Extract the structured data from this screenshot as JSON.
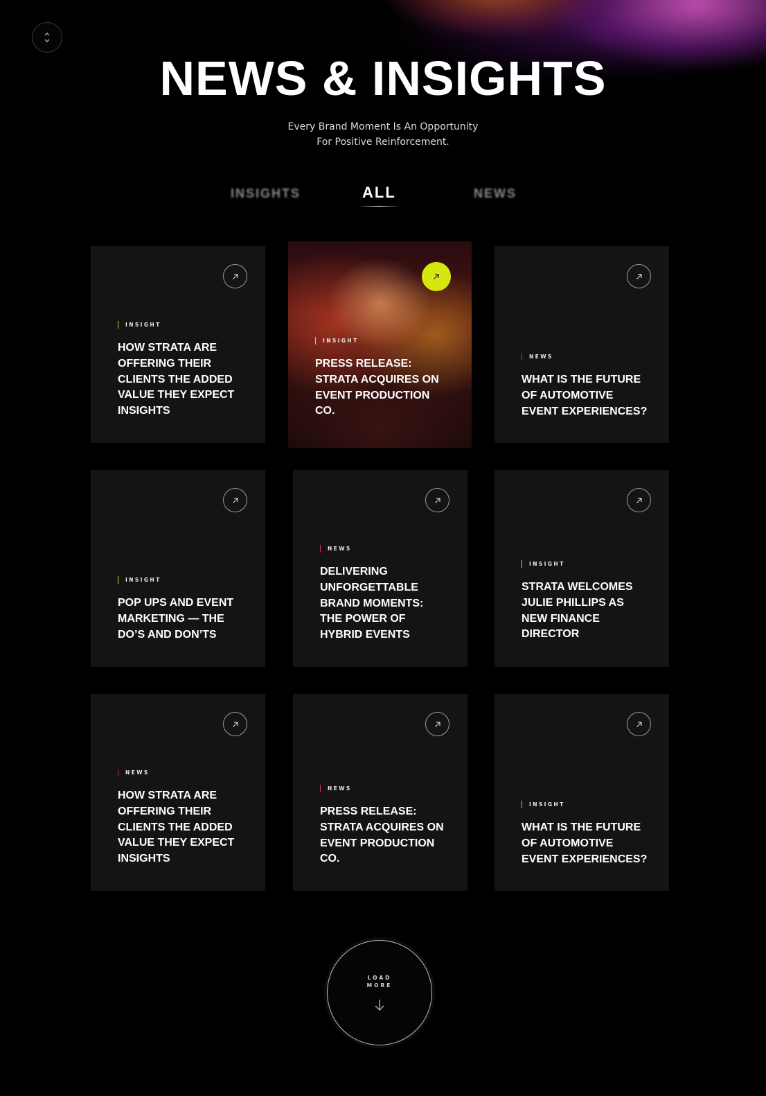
{
  "header": {
    "title": "NEWS & INSIGHTS",
    "subtitle_line1": "Every Brand Moment Is An Opportunity",
    "subtitle_line2": "For Positive Reinforcement."
  },
  "tabs": [
    {
      "label": "INSIGHTS",
      "active": false
    },
    {
      "label": "ALL",
      "active": true
    },
    {
      "label": "NEWS",
      "active": false
    }
  ],
  "colors": {
    "accent_lime": "#d6e60f",
    "insight_marker": "#cfe01a",
    "news_marker": "#e0245e",
    "card_bg": "#141414"
  },
  "cards": [
    {
      "tag": "INSIGHT",
      "title_lines": [
        "HOW STRATA ARE",
        "OFFERING THEIR",
        "CLIENTS THE ADDED",
        "VALUE THEY EXPECT",
        "INSIGHTS"
      ],
      "icon": "arrow-up-right-icon"
    },
    {
      "tag": "INSIGHT",
      "title_lines": [
        "PRESS RELEASE:",
        "STRATA ACQUIRES ON",
        "EVENT PRODUCTION",
        "CO."
      ],
      "icon": "arrow-up-right-icon",
      "featured": true
    },
    {
      "tag": "NEWS",
      "title_lines": [
        "WHAT IS THE FUTURE",
        "OF AUTOMOTIVE",
        "EVENT EXPERIENCES?"
      ],
      "icon": "arrow-up-right-icon"
    },
    {
      "tag": "INSIGHT",
      "title_lines": [
        "POP UPS AND EVENT",
        "MARKETING — THE",
        "DO’S AND DON’TS"
      ],
      "icon": "arrow-up-right-icon"
    },
    {
      "tag": "NEWS",
      "title_lines": [
        "DELIVERING",
        "UNFORGETTABLE",
        "BRAND MOMENTS:",
        "THE POWER OF",
        "HYBRID EVENTS"
      ],
      "icon": "arrow-up-right-icon"
    },
    {
      "tag": "INSIGHT",
      "title_lines": [
        "STRATA WELCOMES",
        "JULIE PHILLIPS AS",
        "NEW FINANCE",
        "DIRECTOR"
      ],
      "icon": "arrow-up-right-icon"
    },
    {
      "tag": "NEWS",
      "title_lines": [
        "HOW STRATA ARE",
        "OFFERING THEIR",
        "CLIENTS THE ADDED",
        "VALUE THEY EXPECT",
        "INSIGHTS"
      ],
      "icon": "arrow-up-right-icon"
    },
    {
      "tag": "NEWS",
      "title_lines": [
        "PRESS RELEASE:",
        "STRATA ACQUIRES ON",
        "EVENT PRODUCTION",
        "CO."
      ],
      "icon": "arrow-up-right-icon"
    },
    {
      "tag": "INSIGHT",
      "title_lines": [
        "WHAT IS THE FUTURE",
        "OF AUTOMOTIVE",
        "EVENT EXPERIENCES?"
      ],
      "icon": "arrow-up-right-icon"
    }
  ],
  "load_more": {
    "line1": "LOAD",
    "line2": "MORE",
    "icon": "arrow-down-icon"
  },
  "scroll_toggle": {
    "icon": "chevron-up-down-icon"
  }
}
